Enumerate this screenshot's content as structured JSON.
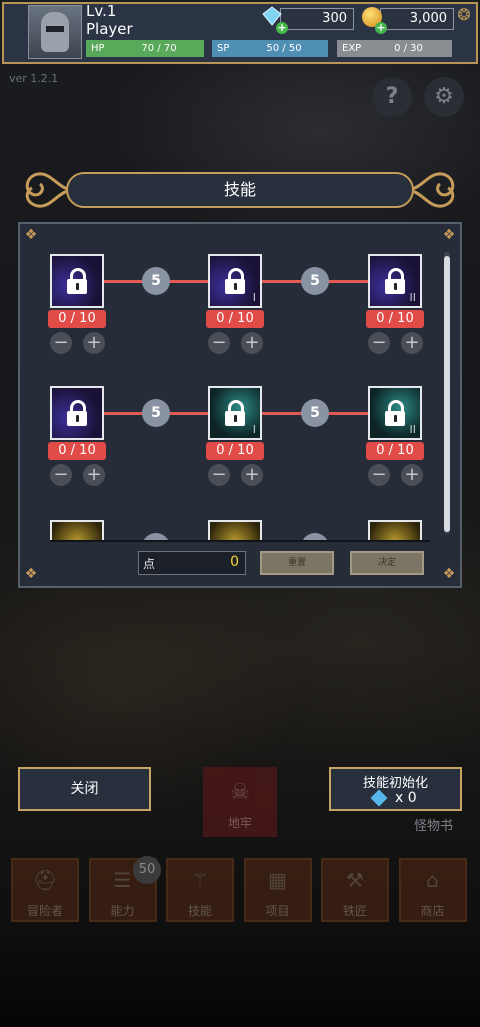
{
  "player": {
    "level": "Lv.1",
    "name": "Player",
    "hp": {
      "label": "HP",
      "value": "70 / 70"
    },
    "sp": {
      "label": "SP",
      "value": "50 / 50"
    },
    "exp": {
      "label": "EXP",
      "value": "0 / 30"
    }
  },
  "currency": {
    "gems": "300",
    "gold": "3,000"
  },
  "version": "ver 1.2.1",
  "panel": {
    "title": "技能",
    "points_label": "点",
    "points_value": "0",
    "reset_label": "重置",
    "confirm_label": "决定"
  },
  "skill_rows": [
    {
      "costs": [
        "5",
        "5"
      ],
      "skills": [
        {
          "style": "purple",
          "level": "0 / 10",
          "roman": ""
        },
        {
          "style": "purple",
          "level": "0 / 10",
          "roman": "I"
        },
        {
          "style": "purple",
          "level": "0 / 10",
          "roman": "II"
        }
      ]
    },
    {
      "costs": [
        "5",
        "5"
      ],
      "skills": [
        {
          "style": "purple",
          "level": "0 / 10",
          "roman": ""
        },
        {
          "style": "teal",
          "level": "0 / 10",
          "roman": "I"
        },
        {
          "style": "teal",
          "level": "0 / 10",
          "roman": "II"
        }
      ]
    }
  ],
  "bottom": {
    "close_label": "关闭",
    "dungeon_label": "地牢",
    "reinit_label": "技能初始化",
    "reinit_count": "x 0",
    "monster_book": "怪物书"
  },
  "tabs": [
    {
      "label": "冒险者",
      "icon": "adventurer-icon"
    },
    {
      "label": "能力",
      "icon": "sliders-icon",
      "badge": "50"
    },
    {
      "label": "技能",
      "icon": "skill-icon"
    },
    {
      "label": "项目",
      "icon": "items-icon"
    },
    {
      "label": "铁匠",
      "icon": "anvil-icon"
    },
    {
      "label": "商店",
      "icon": "shop-icon"
    }
  ]
}
